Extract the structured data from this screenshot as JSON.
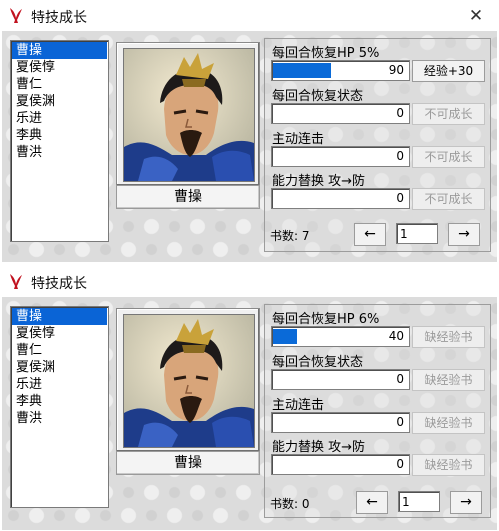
{
  "windows": [
    {
      "title": "特技成长",
      "generals": [
        "曹操",
        "夏侯惇",
        "曹仁",
        "夏侯渊",
        "乐进",
        "李典",
        "曹洪"
      ],
      "selected": 0,
      "name_button": "曹操",
      "skills": [
        {
          "label": "每回合恢复HP 5%",
          "value": "90",
          "progress": 0.43,
          "button": "经验+30",
          "button_enabled": true
        },
        {
          "label": "每回合恢复状态",
          "value": "0",
          "progress": 0,
          "button": "不可成长",
          "button_enabled": false
        },
        {
          "label": "主动连击",
          "value": "0",
          "progress": 0,
          "button": "不可成长",
          "button_enabled": false
        },
        {
          "label": "能力替换 攻→防",
          "value": "0",
          "progress": 0,
          "button": "不可成长",
          "button_enabled": false
        }
      ],
      "books_label": "书数: 7",
      "prev_label": "←",
      "page_value": "1",
      "next_label": "→"
    },
    {
      "title": "特技成长",
      "generals": [
        "曹操",
        "夏侯惇",
        "曹仁",
        "夏侯渊",
        "乐进",
        "李典",
        "曹洪"
      ],
      "selected": 0,
      "name_button": "曹操",
      "skills": [
        {
          "label": "每回合恢复HP 6%",
          "value": "40",
          "progress": 0.18,
          "button": "缺经验书",
          "button_enabled": false
        },
        {
          "label": "每回合恢复状态",
          "value": "0",
          "progress": 0,
          "button": "缺经验书",
          "button_enabled": false
        },
        {
          "label": "主动连击",
          "value": "0",
          "progress": 0,
          "button": "缺经验书",
          "button_enabled": false
        },
        {
          "label": "能力替换 攻→防",
          "value": "0",
          "progress": 0,
          "button": "缺经验书",
          "button_enabled": false
        }
      ],
      "books_label": "书数: 0",
      "prev_label": "←",
      "page_value": "1",
      "next_label": "→"
    }
  ],
  "icons": {
    "app": "red-bird-icon",
    "close": "close-icon"
  },
  "colors": {
    "selection": "#0a64d6",
    "progress": "#0a6ad8",
    "client_bg": "#dcdcdc"
  }
}
